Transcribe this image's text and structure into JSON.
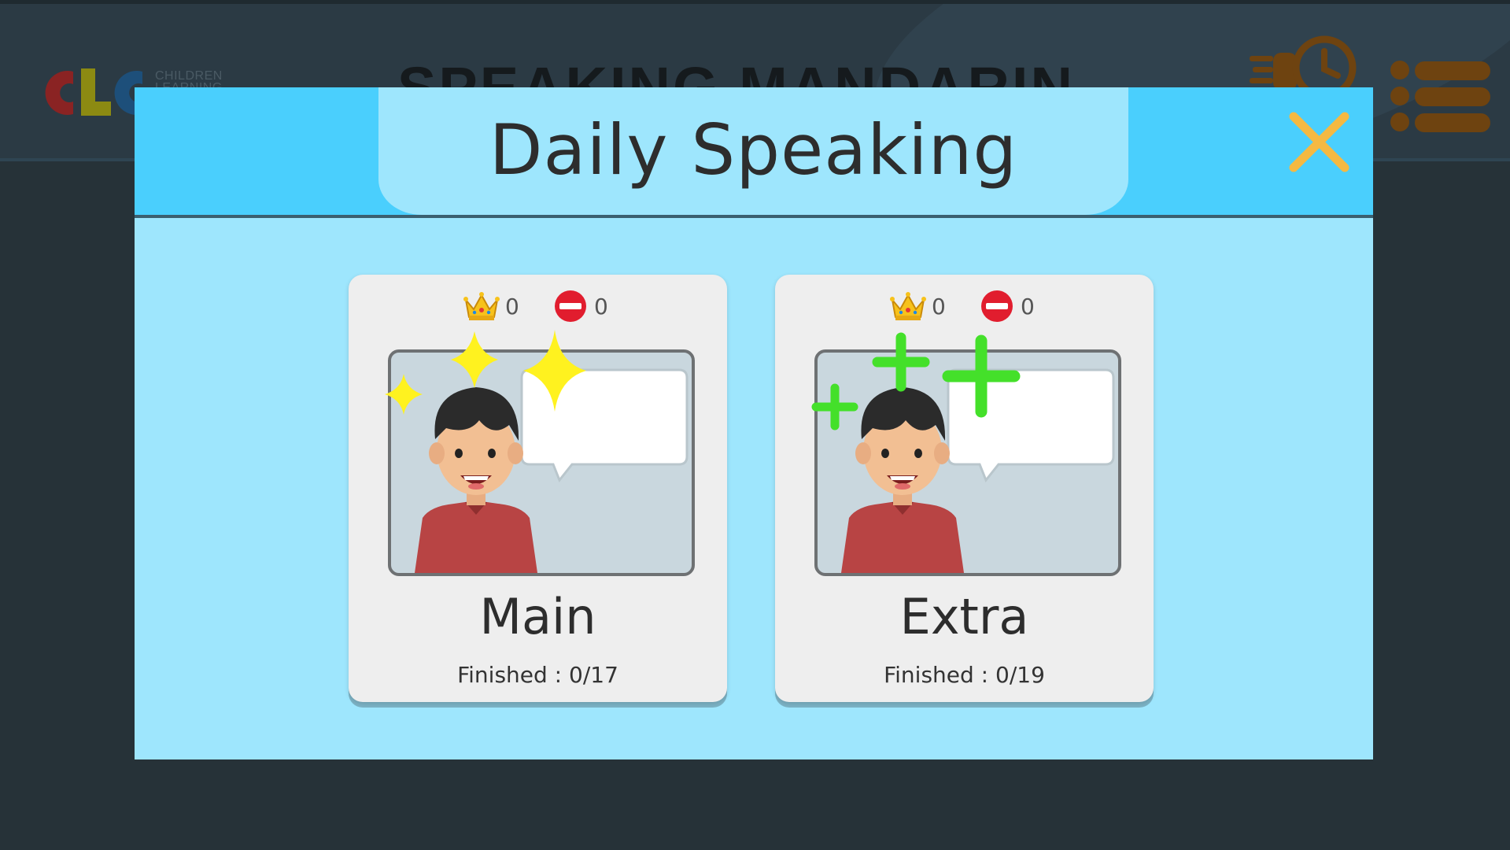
{
  "background": {
    "logo_text_line1": "CHILDREN",
    "logo_text_line2": "LEARNING",
    "title": "SPEAKING MANDARIN",
    "icons": [
      "clc-logo",
      "timer-icon",
      "menu-icon"
    ]
  },
  "modal": {
    "title": "Daily Speaking",
    "close_icon": "close-icon",
    "colors": {
      "header": "#4acffd",
      "body": "#9ee6fd",
      "close": "#f5b942"
    }
  },
  "cards": [
    {
      "label": "Main",
      "crowns": "0",
      "failed": "0",
      "progress_label": "Finished :",
      "progress_value": "0/17",
      "decoration": "sparkle-icon",
      "decoration_color": "#fff21f"
    },
    {
      "label": "Extra",
      "crowns": "0",
      "failed": "0",
      "progress_label": "Finished :",
      "progress_value": "0/19",
      "decoration": "plus-icon",
      "decoration_color": "#44e02a"
    }
  ]
}
